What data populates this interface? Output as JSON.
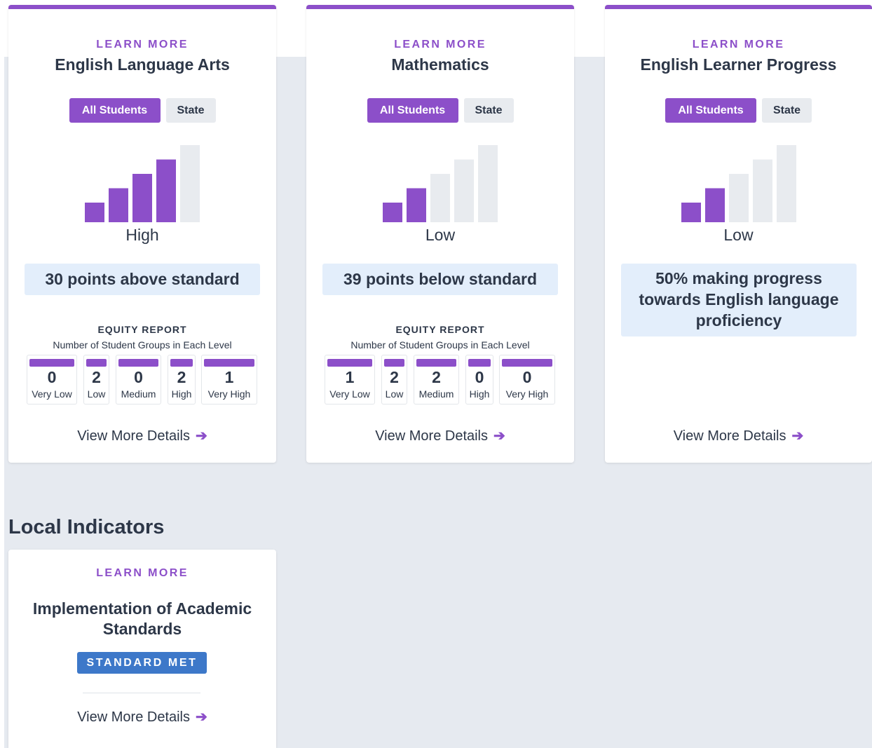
{
  "indicator_cards": [
    {
      "learn_more": "LEARN MORE",
      "title": "English Language Arts",
      "toggle_active": "All Students",
      "toggle_inactive": "State",
      "level": "High",
      "filled_bars": 4,
      "status": "30 points above standard",
      "equity": {
        "title": "EQUITY REPORT",
        "subtitle": "Number of Student Groups in Each Level",
        "levels": [
          {
            "count": "0",
            "label": "Very Low"
          },
          {
            "count": "2",
            "label": "Low"
          },
          {
            "count": "0",
            "label": "Medium"
          },
          {
            "count": "2",
            "label": "High"
          },
          {
            "count": "1",
            "label": "Very High"
          }
        ]
      },
      "view_more": "View More Details"
    },
    {
      "learn_more": "LEARN MORE",
      "title": "Mathematics",
      "toggle_active": "All Students",
      "toggle_inactive": "State",
      "level": "Low",
      "filled_bars": 2,
      "status": "39 points below standard",
      "equity": {
        "title": "EQUITY REPORT",
        "subtitle": "Number of Student Groups in Each Level",
        "levels": [
          {
            "count": "1",
            "label": "Very Low"
          },
          {
            "count": "2",
            "label": "Low"
          },
          {
            "count": "2",
            "label": "Medium"
          },
          {
            "count": "0",
            "label": "High"
          },
          {
            "count": "0",
            "label": "Very High"
          }
        ]
      },
      "view_more": "View More Details"
    },
    {
      "learn_more": "LEARN MORE",
      "title": "English Learner Progress",
      "toggle_active": "All Students",
      "toggle_inactive": "State",
      "level": "Low",
      "filled_bars": 2,
      "status_lines": [
        "50% making progress",
        "towards English language",
        "proficiency"
      ],
      "view_more": "View More Details"
    }
  ],
  "local_section": {
    "heading": "Local Indicators",
    "card": {
      "learn_more": "LEARN MORE",
      "title_lines": [
        "Implementation of Academic",
        "Standards"
      ],
      "badge": "STANDARD MET",
      "view_more": "View More Details"
    }
  },
  "colors": {
    "accent": "#8c4fc9",
    "bar_empty": "#e8ebef",
    "status_bg": "#e3eefb",
    "badge": "#3d78c9",
    "page_bg": "#e6eaf0"
  },
  "icons": {
    "view_more": "arrow-right-icon",
    "level_chart": "signal-bars-icon"
  }
}
